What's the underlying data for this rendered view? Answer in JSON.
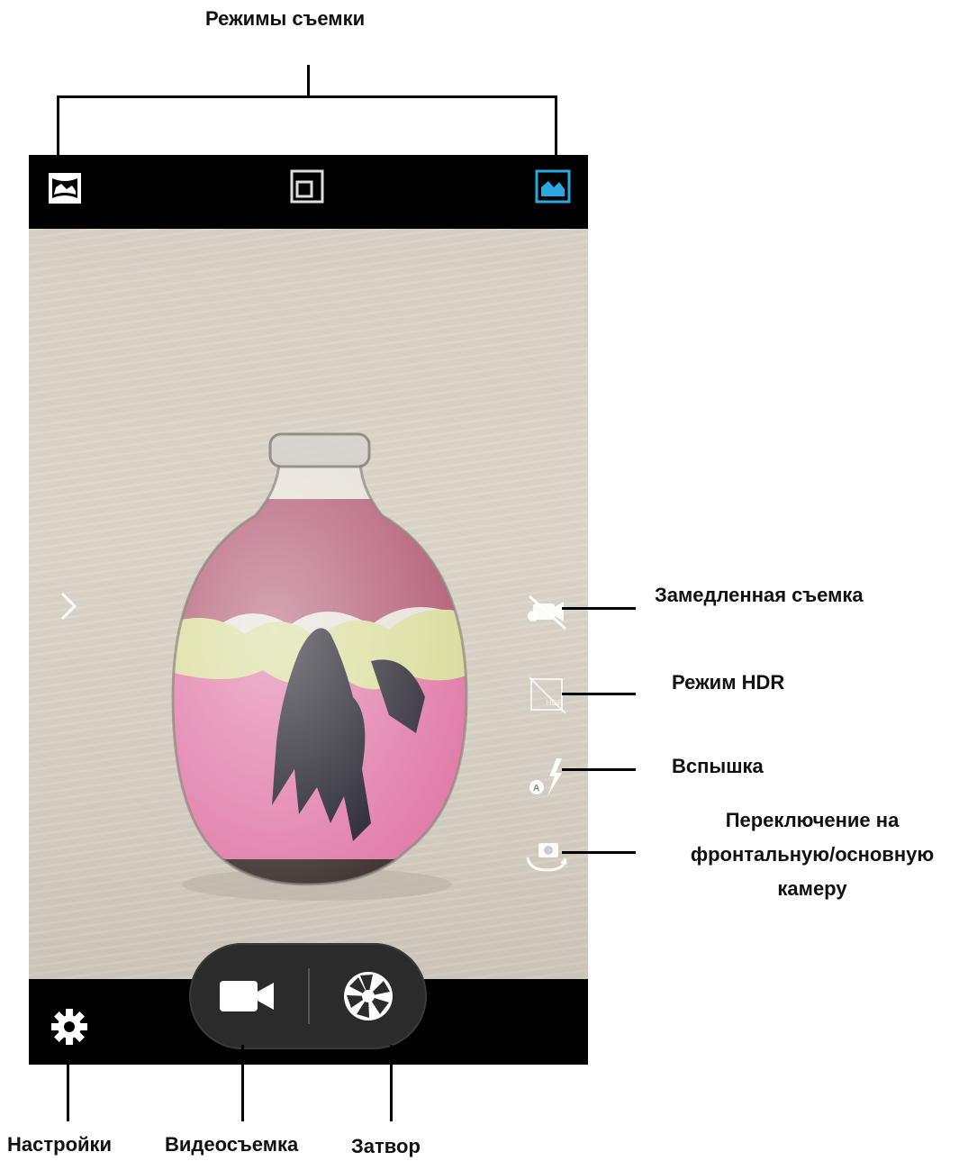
{
  "annotations": {
    "shooting_modes": "Режимы съемки",
    "slow_motion": "Замедленная съемка",
    "hdr_mode": "Режим HDR",
    "flash": "Вспышка",
    "switch_camera_line1": "Переключение на",
    "switch_camera_line2": "фронтальную/основную",
    "switch_camera_line3": "камеру",
    "settings": "Настройки",
    "video": "Видеосъемка",
    "shutter": "Затвор"
  },
  "icons": {
    "top_left": "panorama-mode-icon",
    "top_center": "picture-in-picture-mode-icon",
    "top_right": "photo-mode-icon",
    "side_expand": "chevron-right-icon",
    "side_1": "slow-motion-off-icon",
    "side_2": "hdr-off-icon",
    "side_3": "flash-auto-icon",
    "side_4": "switch-camera-icon",
    "bottom_left": "gear-icon",
    "pill_left": "video-camera-icon",
    "pill_right": "shutter-aperture-icon"
  },
  "colors": {
    "active_mode": "#2aa8e0",
    "bar": "#000000",
    "pill": "#2b2b2b"
  }
}
